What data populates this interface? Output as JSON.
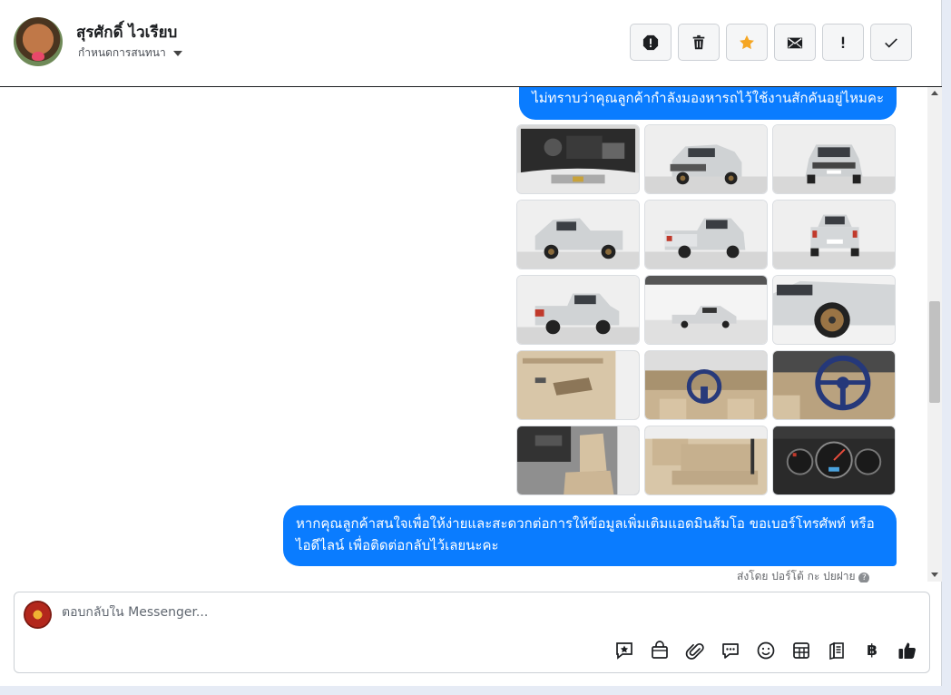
{
  "header": {
    "contact_name": "สุรศักดิ์ ไวเรียบ",
    "assign_label": "กำหนดการสนทนา"
  },
  "toolbar": {
    "icons": [
      "spam-icon",
      "trash-icon",
      "star-icon",
      "envelope-icon",
      "exclamation-icon",
      "check-icon"
    ],
    "accent_star": "#f5a623"
  },
  "messages": {
    "first_text": "ไม่ทราบว่าคุณลูกค้ากำลังมองหารถไว้ใช้งานสักคันอยู่ไหมคะ",
    "second_text": "หากคุณลูกค้าสนใจเพื่อให้ง่ายและสะดวกต่อการให้ข้อมูลเพิ่มเติมแอดมินส้มโอ ขอเบอร์โทรศัพท์ หรือ ไอดีไลน์ เพื่อติดต่อกลับไว้เลยนะคะ",
    "sent_by": "ส่งโดย ปอร์โต้ กะ ปยฝาย",
    "bubble_color": "#0a7cff"
  },
  "photos": [
    "engine-bay",
    "front-three-quarter",
    "front",
    "side-front",
    "rear-three-quarter",
    "rear",
    "side-rear",
    "wide-side",
    "wheel-closeup",
    "door-panel",
    "dashboard",
    "steering-wheel",
    "front-seat",
    "rear-seat",
    "gauge-cluster"
  ],
  "composer": {
    "placeholder": "ตอบกลับใน Messenger...",
    "tools": [
      "saved-reply-icon",
      "shop-icon",
      "attachment-icon",
      "chat-bubble-icon",
      "emoji-icon",
      "table-icon",
      "notebook-icon",
      "baht-icon",
      "like-icon"
    ],
    "baht_symbol": "฿"
  }
}
